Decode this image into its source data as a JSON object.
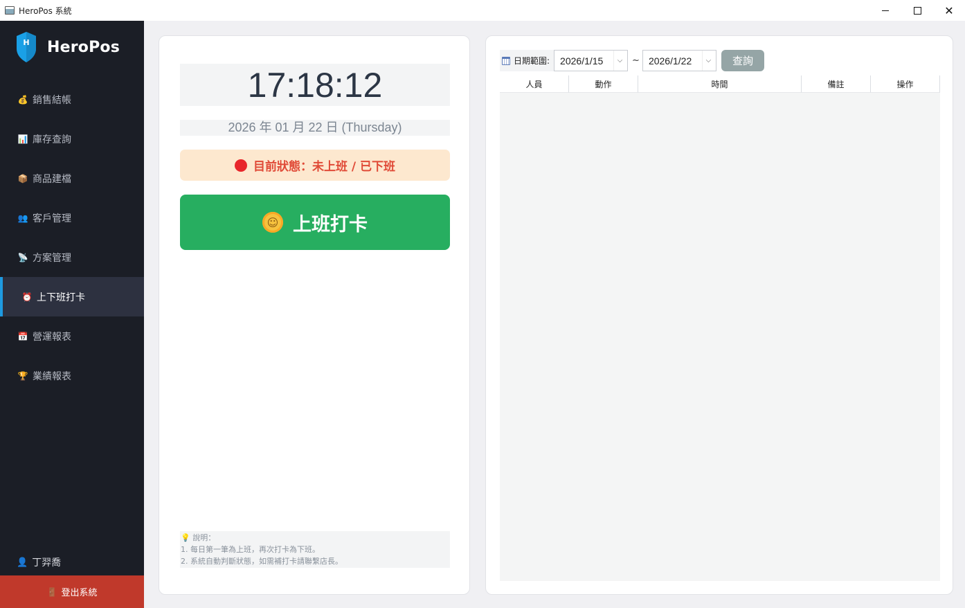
{
  "window": {
    "title": "HeroPos 系統",
    "close_glyph": "✕"
  },
  "sidebar": {
    "brand": "HeroPos",
    "logo_letter": "H",
    "items": [
      {
        "label": "銷售結帳",
        "icon": "money-bag-icon",
        "glyph": "💰",
        "active": false
      },
      {
        "label": "庫存查詢",
        "icon": "chart-icon",
        "glyph": "📊",
        "active": false
      },
      {
        "label": "商品建檔",
        "icon": "package-icon",
        "glyph": "📦",
        "active": false
      },
      {
        "label": "客戶管理",
        "icon": "people-icon",
        "glyph": "👥",
        "active": false
      },
      {
        "label": "方案管理",
        "icon": "satellite-icon",
        "glyph": "📡",
        "active": false
      },
      {
        "label": "上下班打卡",
        "icon": "alarm-clock-icon",
        "glyph": "⏰",
        "active": true
      },
      {
        "label": "營運報表",
        "icon": "calendar-icon",
        "glyph": "📅",
        "active": false
      },
      {
        "label": "業績報表",
        "icon": "trophy-icon",
        "glyph": "🏆",
        "active": false
      }
    ],
    "user_name": "丁羿喬",
    "user_glyph": "👤",
    "logout_label": "登出系統",
    "logout_glyph": "🚪",
    "accent": "#1e9ae0"
  },
  "clock_panel": {
    "time": "17:18:12",
    "date": "2026 年 01 月 22 日 (Thursday)",
    "status": "目前狀態：未上班 / 已下班",
    "status_color": "#e04a37",
    "punch_label": "上班打卡",
    "punch_glyph": "☺",
    "punch_color": "#27ae60",
    "note_title": "💡 說明：",
    "note_line1": "1. 每日第一筆為上班，再次打卡為下班。",
    "note_line2": "2. 系統自動判斷狀態，如需補打卡請聯繫店長。"
  },
  "records_panel": {
    "filter_label": "日期範圍:",
    "start_date": "2026/1/15",
    "end_date": "2026/1/22",
    "separator": "~",
    "chevron": "⌵",
    "query_label": "查詢",
    "columns": [
      "人員",
      "動作",
      "時間",
      "備註",
      "操作"
    ],
    "rows": []
  }
}
